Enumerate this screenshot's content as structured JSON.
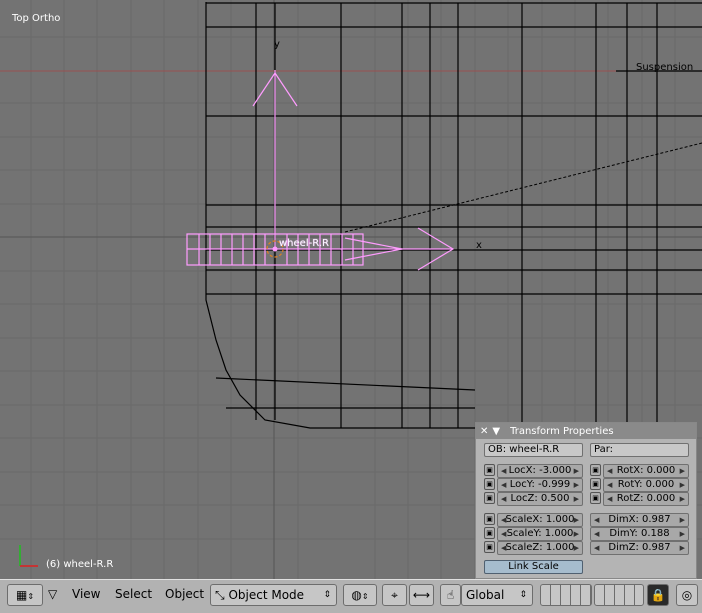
{
  "viewport": {
    "title": "Top Ortho",
    "object_status": "(6) wheel-R.R",
    "axis_y_label": "y",
    "axis_x_label": "x",
    "object_center_label": "wheel-R.R",
    "suspension_label": "Suspension"
  },
  "transform_panel": {
    "title": "Transform Properties",
    "ob_field": "OB: wheel-R.R",
    "par_field": "Par:",
    "loc": [
      {
        "label": "LocX: -3.000"
      },
      {
        "label": "LocY: -0.999"
      },
      {
        "label": "LocZ: 0.500"
      }
    ],
    "rot": [
      {
        "label": "RotX: 0.000"
      },
      {
        "label": "RotY: 0.000"
      },
      {
        "label": "RotZ: 0.000"
      }
    ],
    "scale": [
      {
        "label": "ScaleX: 1.000"
      },
      {
        "label": "ScaleY: 1.000"
      },
      {
        "label": "ScaleZ: 1.000"
      }
    ],
    "dim": [
      {
        "label": "DimX: 0.987"
      },
      {
        "label": "DimY: 0.188"
      },
      {
        "label": "DimZ: 0.987"
      }
    ],
    "link_scale_label": "Link Scale"
  },
  "header": {
    "menus": {
      "view": "View",
      "select": "Select",
      "object": "Object"
    },
    "mode_select": "Object Mode",
    "orientation_select": "Global"
  },
  "colors": {
    "viewport_bg": "#737373",
    "selected_wire": "#ff9cff",
    "panel_bg": "#b4b4b4",
    "header_bg": "#b2b2b2"
  }
}
